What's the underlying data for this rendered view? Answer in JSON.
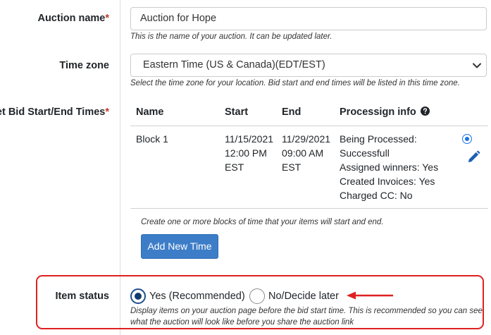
{
  "form": {
    "auction_name": {
      "label": "Auction name",
      "required_mark": "*",
      "value": "Auction for Hope",
      "help": "This is the name of your auction. It can be updated later."
    },
    "time_zone": {
      "label": "Time zone",
      "selected": "Eastern Time (US & Canada)(EDT/EST)",
      "help": "Select the time zone for your location. Bid start and end times will be listed in this time zone."
    },
    "bid_times": {
      "label": "Set Bid Start/End Times",
      "required_mark": "*",
      "columns": [
        "Name",
        "Start",
        "End",
        "Processign info"
      ],
      "rows": [
        {
          "name": "Block 1",
          "start": [
            "11/15/2021",
            "12:00 PM",
            "EST"
          ],
          "end": [
            "11/29/2021",
            "09:00 AM",
            "EST"
          ],
          "info": [
            "Being Processed:",
            "Successfull",
            "Assigned winners: Yes",
            "Created Invoices: Yes",
            "Charged CC: No"
          ],
          "selected": true
        }
      ],
      "help": "Create one or more blocks of time that your items will start and end.",
      "add_button": "Add New Time"
    },
    "item_status": {
      "label": "Item status",
      "options": [
        {
          "label": "Yes (Recommended)",
          "selected": true
        },
        {
          "label": "No/Decide later",
          "selected": false
        }
      ],
      "help": "Display items on your auction page before the bid start time. This is recommended so you can see what the auction will look like before you share the auction link"
    }
  },
  "colors": {
    "required": "#c0392b",
    "button": "#3d7dc8",
    "highlight_box": "#e02020",
    "radio_selected": "#123b6e",
    "row_radio": "#1a73e8"
  },
  "icons": {
    "info": "question-circle-icon",
    "edit": "pencil-icon",
    "select": "chevron-down-icon",
    "annotation": "arrow-left-icon"
  }
}
